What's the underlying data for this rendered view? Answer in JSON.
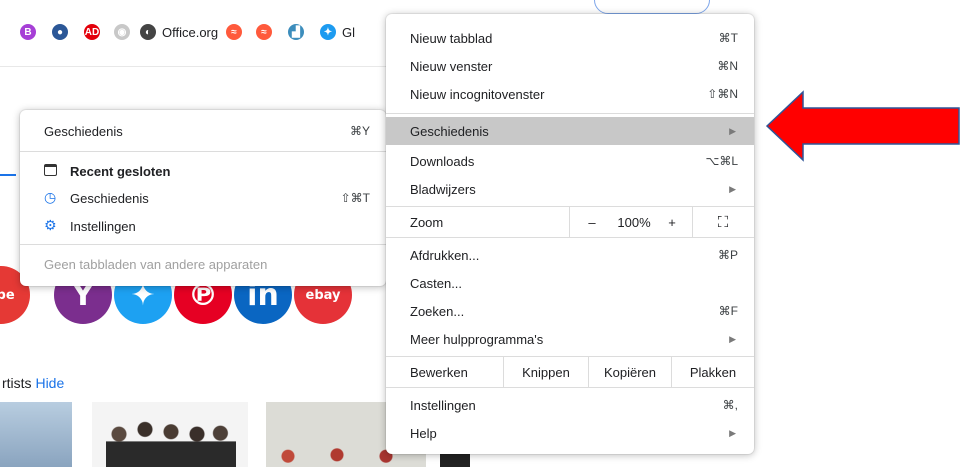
{
  "bookmarks": [
    {
      "icon": "b-logo-icon",
      "glyph": "B",
      "color": "#a63fd6",
      "text": ""
    },
    {
      "icon": "circle-logo-icon",
      "glyph": "●",
      "color": "#2b5797",
      "text": ""
    },
    {
      "icon": "ad-logo-icon",
      "glyph": "AD",
      "color": "#e3000b",
      "text": ""
    },
    {
      "icon": "gray-circle-icon",
      "glyph": "◉",
      "color": "#c8c8c8",
      "text": ""
    },
    {
      "icon": "globe-icon",
      "glyph": "◐",
      "color": "#444444",
      "text": "Office.org"
    },
    {
      "icon": "ribbon-icon",
      "glyph": "≈",
      "color": "#ff5a3c",
      "text": ""
    },
    {
      "icon": "ribbon-icon",
      "glyph": "≈",
      "color": "#ff5a3c",
      "text": ""
    },
    {
      "icon": "chart-icon",
      "glyph": "▟",
      "color": "#3c8dbc",
      "text": ""
    },
    {
      "icon": "twitter-icon",
      "glyph": "✦",
      "color": "#1d9bf0",
      "text": "Gl"
    }
  ],
  "page": {
    "artists_text": "rtists",
    "hide_text": "Hide",
    "social": [
      {
        "icon": "youtube-icon",
        "color": "#e53935",
        "glyph": "ube"
      },
      {
        "icon": "yahoo-icon",
        "color": "#7b2e8e",
        "glyph": "Y"
      },
      {
        "icon": "twitter-icon",
        "color": "#1da1f2",
        "glyph": "✦"
      },
      {
        "icon": "pinterest-icon",
        "color": "#e60023",
        "glyph": "℗"
      },
      {
        "icon": "linkedin-icon",
        "color": "#0a66c2",
        "glyph": "in"
      },
      {
        "icon": "ebay-icon",
        "color": "#e53238",
        "glyph": "ebay"
      }
    ]
  },
  "history_menu": {
    "title": "Geschiedenis",
    "title_shortcut": "⌘Y",
    "recent_closed": "Recent gesloten",
    "history": "Geschiedenis",
    "history_shortcut": "⇧⌘T",
    "settings": "Instellingen",
    "no_tabs": "Geen tabbladen van andere apparaten"
  },
  "main_menu": {
    "new_tab": "Nieuw tabblad",
    "new_tab_sc": "⌘T",
    "new_window": "Nieuw venster",
    "new_window_sc": "⌘N",
    "incognito": "Nieuw incognitovenster",
    "incognito_sc": "⇧⌘N",
    "history": "Geschiedenis",
    "downloads": "Downloads",
    "downloads_sc": "⌥⌘L",
    "bookmarks": "Bladwijzers",
    "zoom": "Zoom",
    "zoom_minus": "–",
    "zoom_value": "100%",
    "zoom_plus": "+",
    "fullscreen": "⛶",
    "print": "Afdrukken...",
    "print_sc": "⌘P",
    "cast": "Casten...",
    "find": "Zoeken...",
    "find_sc": "⌘F",
    "more_tools": "Meer hulpprogramma's",
    "edit": "Bewerken",
    "cut": "Knippen",
    "copy": "Kopiëren",
    "paste": "Plakken",
    "settings": "Instellingen",
    "settings_sc": "⌘,",
    "help": "Help",
    "submenu_arrow": "▶"
  },
  "colors": {
    "highlight": "#c8c8c8",
    "arrow_fill": "#ff0000",
    "arrow_stroke": "#2f5597"
  }
}
